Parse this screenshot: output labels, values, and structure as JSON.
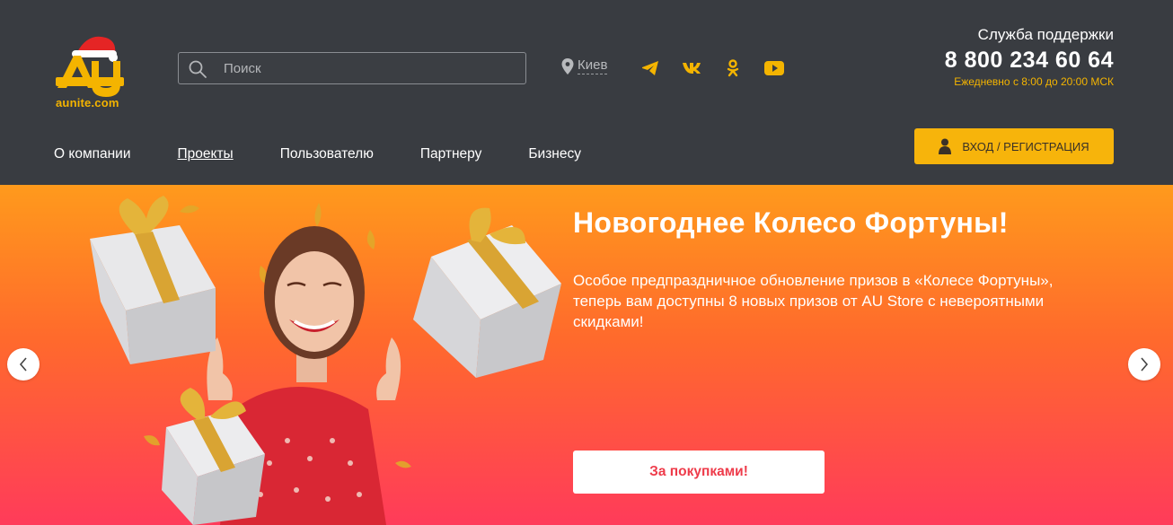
{
  "colors": {
    "header_bg": "#393c41",
    "accent": "#f7b40b",
    "banner_top": "#ff9a1c",
    "banner_bottom": "#ff3b5a",
    "cta_text": "#ee3b4a"
  },
  "header": {
    "logo_text": "aunite.com",
    "search": {
      "placeholder": "Поиск",
      "icon": "search-icon"
    },
    "city": {
      "label": "Киев",
      "icon": "location-pin-icon"
    },
    "socials": [
      {
        "icon": "telegram-icon"
      },
      {
        "icon": "vk-icon"
      },
      {
        "icon": "odnoklassniki-icon"
      },
      {
        "icon": "youtube-icon"
      }
    ],
    "support": {
      "title": "Служба поддержки",
      "phone": "8 800 234 60 64",
      "hours": "Ежедневно с 8:00 до 20:00 МСК"
    },
    "nav": [
      {
        "label": "О компании",
        "active": false
      },
      {
        "label": "Проекты",
        "active": true
      },
      {
        "label": "Пользователю",
        "active": false
      },
      {
        "label": "Партнеру",
        "active": false
      },
      {
        "label": "Бизнесу",
        "active": false
      }
    ],
    "login": {
      "label": "ВХОД / РЕГИСТРАЦИЯ",
      "icon": "user-icon"
    }
  },
  "banner": {
    "title": "Новогоднее Колесо Фортуны!",
    "description": "Особое предпраздничное обновление призов в «Колесе Фортуны», теперь вам доступны 8 новых призов от AU Store с невероятными скидками!",
    "cta": "За покупками!",
    "prev_icon": "chevron-left-icon",
    "next_icon": "chevron-right-icon"
  }
}
